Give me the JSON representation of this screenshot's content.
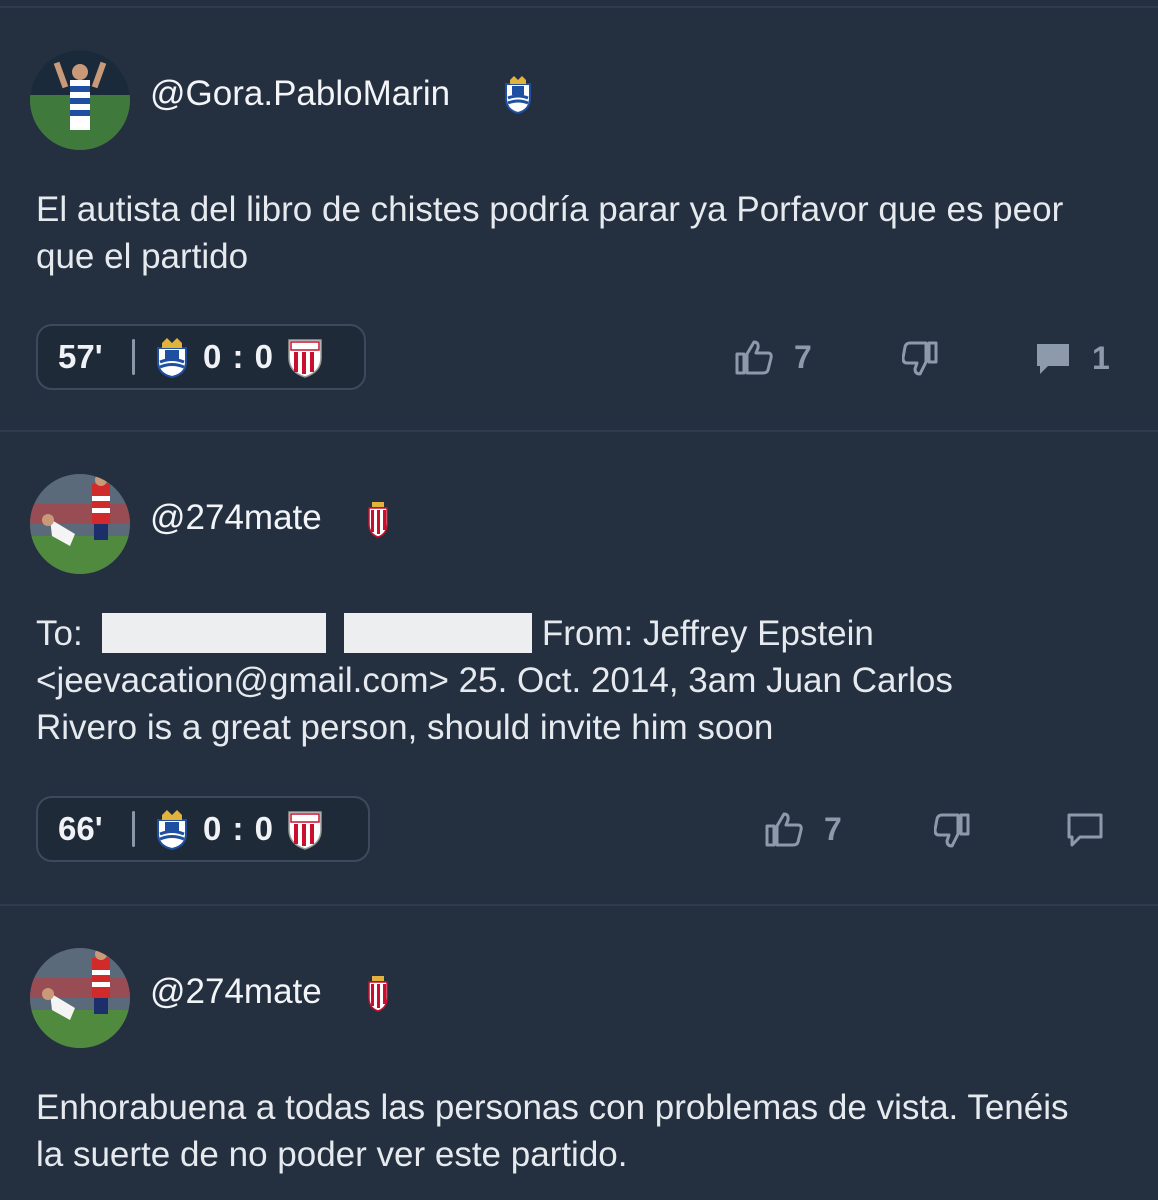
{
  "posts": [
    {
      "username": "@Gora.PabloMarin",
      "text": "El autista del libro de chistes podría parar ya Porfavor que es peor que el partido",
      "minute": "57'",
      "score": "0 : 0",
      "likes": "7",
      "comments": "1",
      "team_badge": "real-sociedad-crest"
    },
    {
      "username": "@274mate",
      "text_to": "To:",
      "text_rest_line1": "From: Jeffrey Epstein",
      "text_line2": "<jeevacation@gmail.com> 25. Oct. 2014, 3am Juan Carlos",
      "text_line3": "Rivero is a great person, should invite him soon",
      "minute": "66'",
      "score": "0 : 0",
      "likes": "7",
      "team_badge": "sporting-gijon-crest"
    },
    {
      "username": "@274mate",
      "text": "Enhorabuena a todas las personas con problemas de vista. Tenéis la suerte de no poder ver este partido.",
      "team_badge": "sporting-gijon-crest"
    }
  ],
  "colors": {
    "background": "#243040",
    "divider": "#2f3c4d",
    "muted": "#8d9aab",
    "text": "#e6eaef"
  }
}
